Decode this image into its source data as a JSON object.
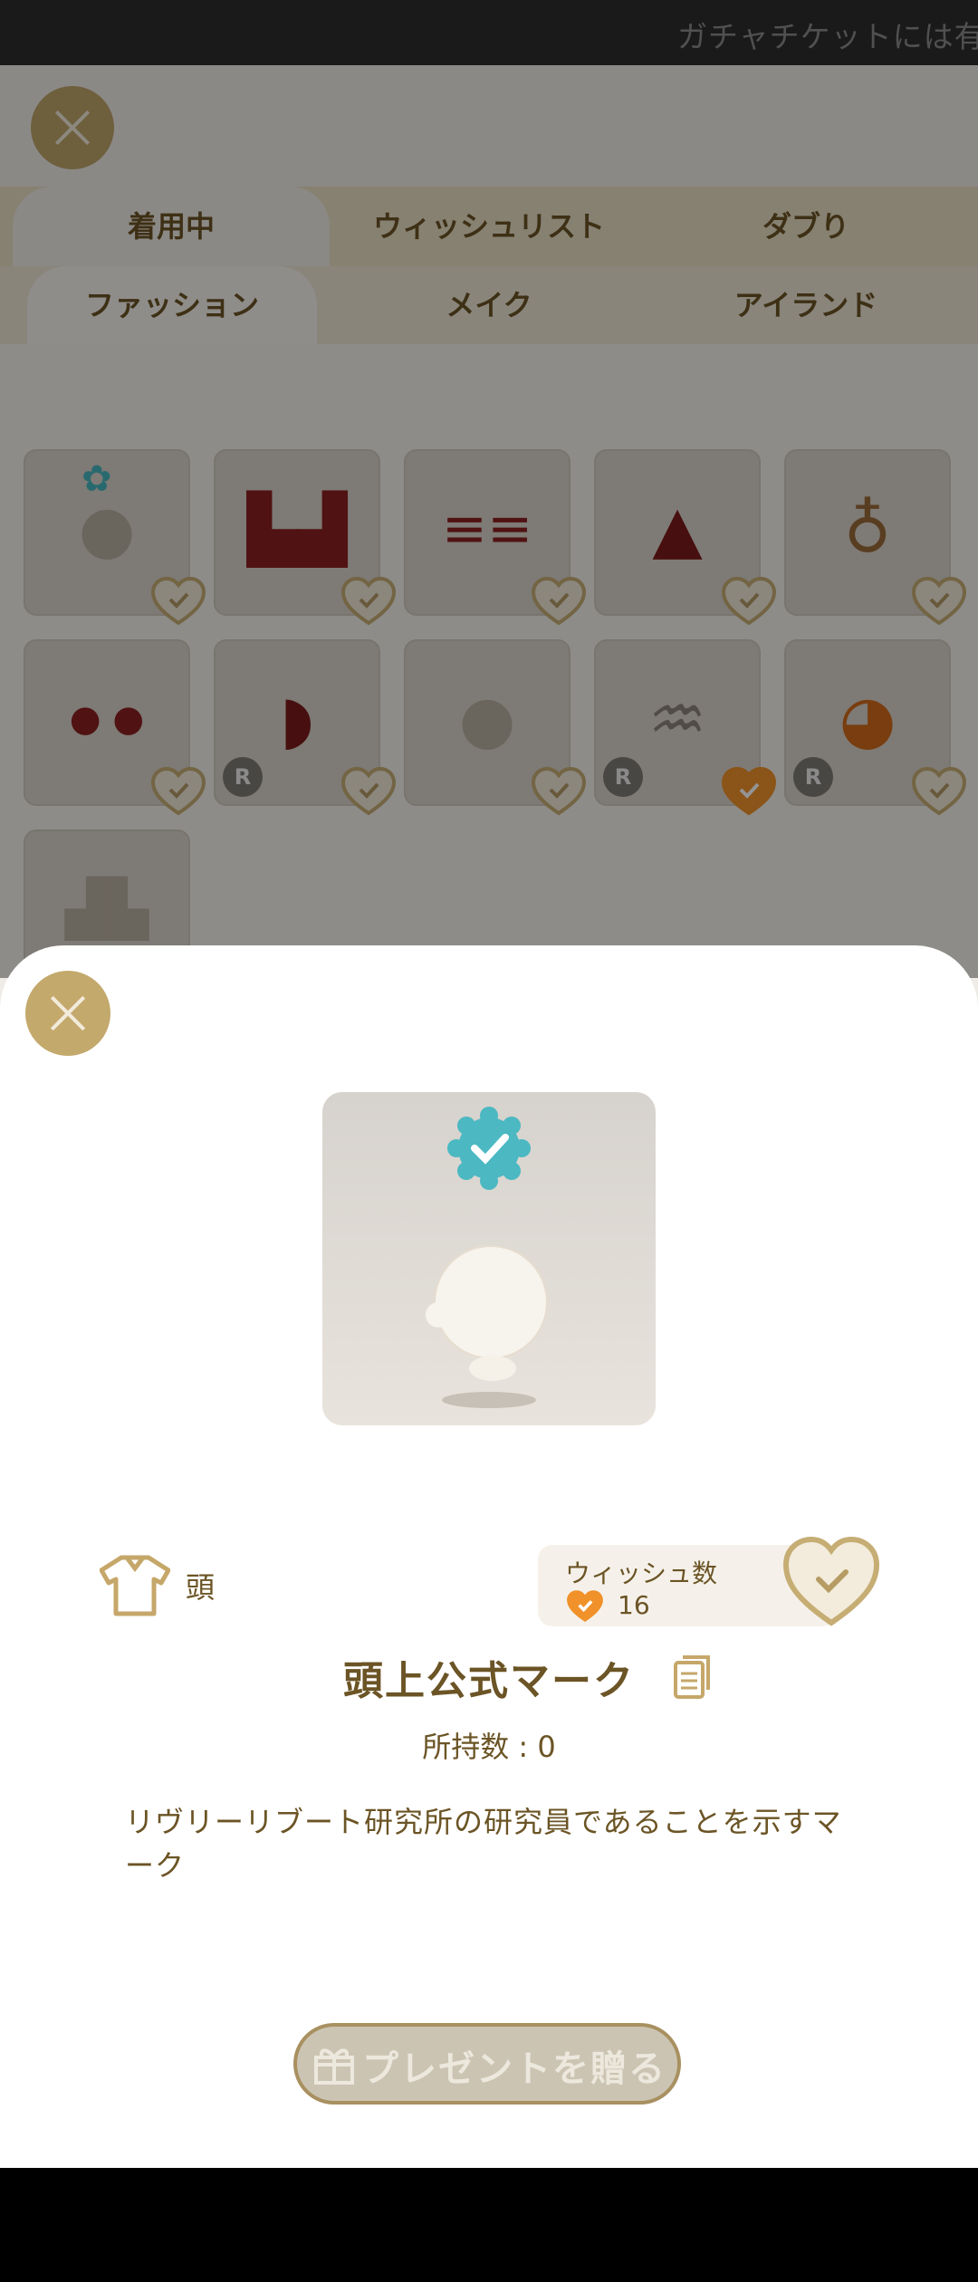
{
  "ticker": {
    "text": "ガチャチケットには有"
  },
  "tabs_top": [
    {
      "label": "着用中",
      "active": true
    },
    {
      "label": "ウィッシュリスト",
      "active": false
    },
    {
      "label": "ダブり",
      "active": false
    }
  ],
  "tabs_sub": [
    {
      "label": "ファッション",
      "active": true
    },
    {
      "label": "メイク",
      "active": false
    },
    {
      "label": "アイランド",
      "active": false
    }
  ],
  "items": [
    {
      "name": "head-mark",
      "rare": false,
      "wished": false,
      "badge": true
    },
    {
      "name": "boots",
      "rare": false,
      "wished": false
    },
    {
      "name": "striped-socks",
      "rare": false,
      "wished": false
    },
    {
      "name": "skirt",
      "rare": false,
      "wished": false
    },
    {
      "name": "necklace",
      "rare": false,
      "wished": false
    },
    {
      "name": "gloves",
      "rare": false,
      "wished": false
    },
    {
      "name": "santa-hat",
      "rare": true,
      "rare_label": "R",
      "wished": false
    },
    {
      "name": "earring",
      "rare": false,
      "wished": false
    },
    {
      "name": "hair-long",
      "rare": true,
      "rare_label": "R",
      "wished": true
    },
    {
      "name": "hair-orange",
      "rare": true,
      "rare_label": "R",
      "wished": false
    },
    {
      "name": "shirt-lrl",
      "rare": false,
      "wished": false
    }
  ],
  "detail": {
    "category_label": "頭",
    "wish_title": "ウィッシュ数",
    "wish_count": "16",
    "item_title": "頭上公式マーク",
    "owned_text": "所持数 : 0",
    "description": "リヴリーリブート研究所の研究員であることを示すマーク",
    "present_label": "プレゼントを贈る"
  },
  "colors": {
    "accent_gold": "#bda46a",
    "heart_orange": "#f0912a",
    "badge_teal": "#45b6bf"
  }
}
